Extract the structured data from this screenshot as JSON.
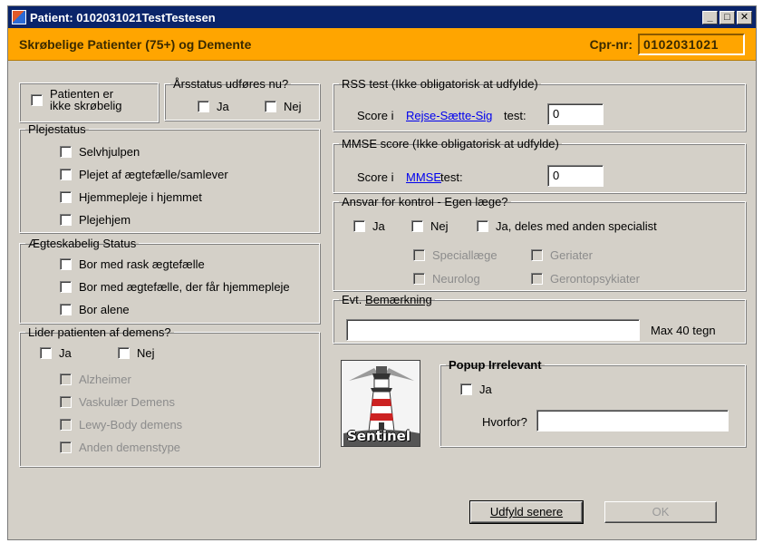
{
  "window": {
    "title": "Patient: 0102031021TestTestesen",
    "minimize": "_",
    "maximize": "□",
    "close": "✕"
  },
  "header": {
    "title": "Skrøbelige Patienter (75+) og Demente",
    "cpr_label": "Cpr-nr:",
    "cpr_value": "0102031021"
  },
  "fragile": {
    "label_line1": "Patienten er",
    "label_line2": "ikke skrøbelig"
  },
  "annual_status": {
    "legend": "Årsstatus udføres nu?",
    "yes": "Ja",
    "no": "Nej"
  },
  "care_status": {
    "legend": "Plejestatus",
    "items": [
      "Selvhjulpen",
      "Plejet af ægtefælle/samlever",
      "Hjemmepleje i hjemmet",
      "Plejehjem"
    ]
  },
  "marital_status": {
    "legend": "Ægteskabelig Status",
    "items": [
      "Bor med rask ægtefælle",
      "Bor med ægtefælle, der får hjemmepleje",
      "Bor alene"
    ]
  },
  "dementia": {
    "legend": "Lider patienten af demens?",
    "yes": "Ja",
    "no": "Nej",
    "types": [
      "Alzheimer",
      "Vaskulær Demens",
      "Lewy-Body demens",
      "Anden demenstype"
    ]
  },
  "rss": {
    "legend": "RSS test (Ikke obligatorisk at udfylde)",
    "prefix": "Score i",
    "link": "Rejse-Sætte-Sig",
    "suffix": "test:",
    "value": "0"
  },
  "mmse": {
    "legend": "MMSE score (Ikke obligatorisk at udfylde)",
    "prefix": "Score i",
    "link": "MMSE",
    "suffix": "test:",
    "value": "0"
  },
  "responsibility": {
    "legend": "Ansvar for kontrol - Egen læge?",
    "yes": "Ja",
    "no": "Nej",
    "shared": "Ja, deles med anden specialist",
    "specialists": [
      "Speciallæge",
      "Geriater",
      "Neurolog",
      "Gerontopsykiater"
    ]
  },
  "remark": {
    "legend_prefix": "Evt.",
    "legend_link": "Bemærkning",
    "value": "",
    "max_label": "Max 40 tegn"
  },
  "logo": {
    "text": "Sentinel"
  },
  "popup": {
    "legend": "Popup Irrelevant",
    "yes": "Ja",
    "why_label": "Hvorfor?",
    "why_value": ""
  },
  "buttons": {
    "later": "Udfyld senere",
    "ok": "OK"
  },
  "colors": {
    "header_bg": "#ffa500",
    "titlebar_bg": "#0a246a",
    "dialog_bg": "#d4d0c8",
    "link": "#0000ee"
  }
}
